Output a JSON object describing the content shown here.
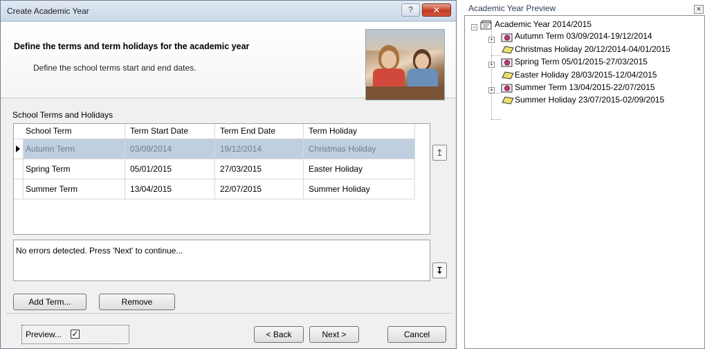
{
  "dialog": {
    "title": "Create Academic Year",
    "help_label": "?",
    "close_label": "✕",
    "heading": "Define the terms and term holidays for the academic year",
    "subheading": "Define the school terms start and end dates.",
    "section_label": "School Terms and Holidays",
    "grid": {
      "columns": [
        "School Term",
        "Term Start Date",
        "Term End Date",
        "Term Holiday"
      ],
      "rows": [
        {
          "term": "Autumn Term",
          "start": "03/09/2014",
          "end": "19/12/2014",
          "holiday": "Christmas Holiday",
          "selected": true
        },
        {
          "term": "Spring Term",
          "start": "05/01/2015",
          "end": "27/03/2015",
          "holiday": "Easter Holiday",
          "selected": false
        },
        {
          "term": "Summer Term",
          "start": "13/04/2015",
          "end": "22/07/2015",
          "holiday": "Summer Holiday",
          "selected": false
        }
      ]
    },
    "move_up_icon": "↥",
    "move_down_icon": "↧",
    "status": "No errors detected. Press 'Next' to continue...",
    "buttons": {
      "add_term": "Add Term...",
      "remove": "Remove",
      "back": "< Back",
      "next": "Next >",
      "cancel": "Cancel"
    },
    "preview_label": "Preview...",
    "preview_checked": "✓"
  },
  "preview_pane": {
    "title": "Academic Year Preview",
    "close_label": "✕",
    "tree": [
      {
        "label": "Academic Year 2014/2015",
        "type": "year",
        "expander": "−"
      },
      {
        "label": "Autumn Term 03/09/2014-19/12/2014",
        "type": "term",
        "expander": "+"
      },
      {
        "label": "Christmas Holiday 20/12/2014-04/01/2015",
        "type": "holiday"
      },
      {
        "label": "Spring Term 05/01/2015-27/03/2015",
        "type": "term",
        "expander": "+"
      },
      {
        "label": "Easter Holiday 28/03/2015-12/04/2015",
        "type": "holiday"
      },
      {
        "label": "Summer Term 13/04/2015-22/07/2015",
        "type": "term",
        "expander": "+"
      },
      {
        "label": "Summer Holiday 23/07/2015-02/09/2015",
        "type": "holiday"
      }
    ]
  },
  "colors": {
    "selected_row": "#bfcfe0",
    "holiday_icon": "#e9df6d",
    "term_icon": "#c23a78",
    "close_button": "#c43d24"
  }
}
